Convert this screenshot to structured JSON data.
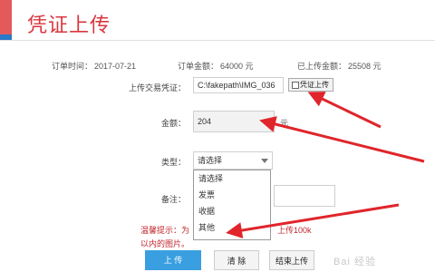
{
  "header": {
    "title": "凭证上传"
  },
  "order_info": {
    "time_label": "订单时间：",
    "time_value": "2017-07-21",
    "amount_label": "订单金额：",
    "amount_value": "64000 元",
    "uploaded_label": "已上传金额：",
    "uploaded_value": "25508 元"
  },
  "form": {
    "voucher_label": "上传交易凭证：",
    "file_path": "C:\\fakepath\\IMG_036",
    "upload_checkbox_label": "凭证上传",
    "amount_label": "金额：",
    "amount_value": "204",
    "amount_unit": "元",
    "type_label": "类型：",
    "type_selected": "请选择",
    "type_options": [
      "请选择",
      "发票",
      "收据",
      "其他"
    ],
    "note_label": "备注："
  },
  "tip": {
    "line1_head": "温馨提示：为",
    "line1_tail": "上传100k",
    "line2": "以内的图片。"
  },
  "buttons": {
    "upload": "上 传",
    "clear": "清 除",
    "finish": "结束上传"
  },
  "watermark": "Bai 经验",
  "colors": {
    "title": "#d9363e",
    "arrow": "#e0252b",
    "primary_button": "#3a9fe0",
    "accent": "#e45a5a"
  }
}
